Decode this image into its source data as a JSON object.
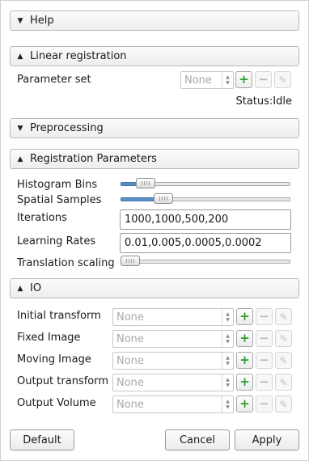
{
  "sections": {
    "help": "Help",
    "linear_registration": "Linear registration",
    "preprocessing": "Preprocessing",
    "registration_parameters": "Registration Parameters",
    "io": "IO"
  },
  "parameter_set": {
    "label": "Parameter set",
    "value": "None"
  },
  "status": {
    "label": "Status:",
    "value": "Idle"
  },
  "params": {
    "histogram_bins": {
      "label": "Histogram Bins",
      "level": 0.1
    },
    "spatial_samples": {
      "label": "Spatial Samples",
      "level": 0.22
    },
    "iterations": {
      "label": "Iterations",
      "value": "1000,1000,500,200"
    },
    "learning_rates": {
      "label": "Learning Rates",
      "value": "0.01,0.005,0.0005,0.0002"
    },
    "translation_scaling": {
      "label": "Translation scaling",
      "level": 0.0
    }
  },
  "io": [
    {
      "label": "Initial transform",
      "value": "None"
    },
    {
      "label": "Fixed Image",
      "value": "None"
    },
    {
      "label": "Moving Image",
      "value": "None"
    },
    {
      "label": "Output transform",
      "value": "None"
    },
    {
      "label": "Output Volume",
      "value": "None"
    }
  ],
  "icons": {
    "add": "+",
    "remove": "−",
    "edit": "✎"
  },
  "buttons": {
    "default": "Default",
    "cancel": "Cancel",
    "apply": "Apply"
  },
  "colors": {
    "accent_green": "#2e9e2e",
    "slider_fill": "#5b8fc7"
  }
}
